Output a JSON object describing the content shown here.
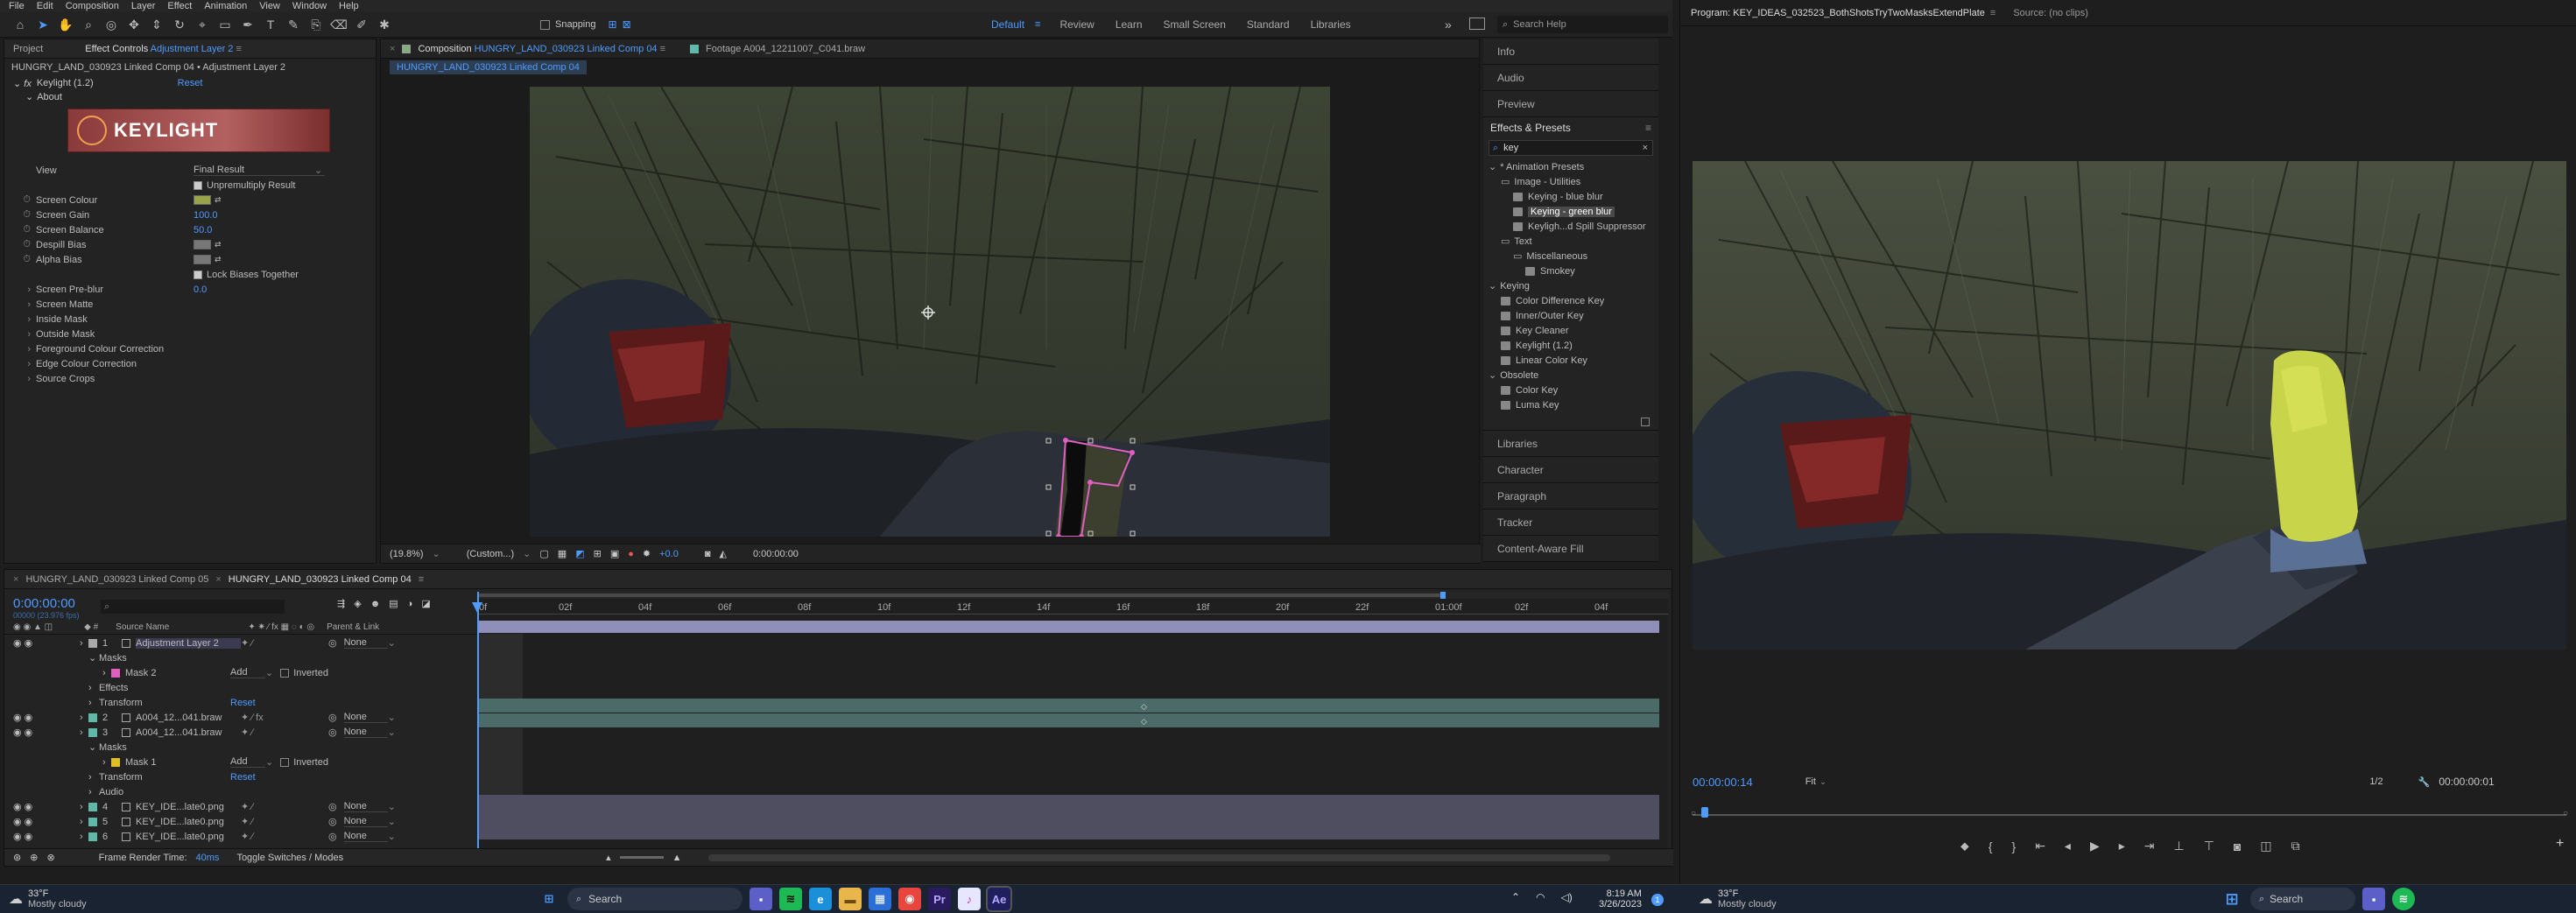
{
  "menu": [
    "File",
    "Edit",
    "Composition",
    "Layer",
    "Effect",
    "Animation",
    "View",
    "Window",
    "Help"
  ],
  "toolbar": {
    "snapping": "Snapping",
    "search_placeholder": "Search Help",
    "workspaces": [
      "Default",
      "Review",
      "Learn",
      "Small Screen",
      "Standard",
      "Libraries"
    ],
    "active_workspace": "Default",
    "more": "»"
  },
  "project_panel": {
    "tab_project": "Project",
    "tab_effect_controls": "Effect Controls",
    "effect_target": "Adjustment Layer 2",
    "path": "HUNGRY_LAND_030923 Linked Comp 04 • Adjustment Layer 2",
    "fx_name": "Keylight (1.2)",
    "reset": "Reset",
    "about": "About",
    "logo": "KEYLIGHT",
    "props": [
      {
        "label": "View",
        "value": "Final Result"
      },
      {
        "label": "",
        "value": "Unpremultiply Result"
      },
      {
        "label": "Screen Colour",
        "value": ""
      },
      {
        "label": "Screen Gain",
        "value": "100.0"
      },
      {
        "label": "Screen Balance",
        "value": "50.0"
      },
      {
        "label": "Despill Bias",
        "value": ""
      },
      {
        "label": "Alpha Bias",
        "value": ""
      },
      {
        "label": "",
        "value": "Lock Biases Together"
      },
      {
        "label": "Screen Pre-blur",
        "value": "0.0"
      },
      {
        "label": "Screen Matte",
        "value": ""
      },
      {
        "label": "Inside Mask",
        "value": ""
      },
      {
        "label": "Outside Mask",
        "value": ""
      },
      {
        "label": "Foreground Colour Correction",
        "value": ""
      },
      {
        "label": "Edge Colour Correction",
        "value": ""
      },
      {
        "label": "Source Crops",
        "value": ""
      }
    ]
  },
  "comp_panel": {
    "tab_comp_prefix": "Composition",
    "tab_comp_name": "HUNGRY_LAND_030923 Linked Comp 04",
    "tab_footage": "Footage  A004_12211007_C041.braw",
    "breadcrumb": "HUNGRY_LAND_030923 Linked Comp 04",
    "zoom": "(19.8%)",
    "resolution": "(Custom...)",
    "exposure": "+0.0",
    "timecode": "0:00:00:00"
  },
  "right_panels": {
    "top": [
      "Info",
      "Audio",
      "Preview"
    ],
    "effects_title": "Effects & Presets",
    "search_value": "key",
    "tree": [
      {
        "label": "* Animation Presets",
        "indent": 0,
        "type": "arrow"
      },
      {
        "label": "Image - Utilities",
        "indent": 1,
        "type": "folder"
      },
      {
        "label": "Keying - blue blur",
        "indent": 2,
        "type": "file"
      },
      {
        "label": "Keying - green blur",
        "indent": 2,
        "type": "file",
        "selected": true
      },
      {
        "label": "Keyligh...d Spill Suppressor",
        "indent": 2,
        "type": "file"
      },
      {
        "label": "Text",
        "indent": 1,
        "type": "folder"
      },
      {
        "label": "Miscellaneous",
        "indent": 2,
        "type": "folder"
      },
      {
        "label": "Smokey",
        "indent": 3,
        "type": "file"
      },
      {
        "label": "Keying",
        "indent": 0,
        "type": "arrow"
      },
      {
        "label": "Color Difference Key",
        "indent": 1,
        "type": "file"
      },
      {
        "label": "Inner/Outer Key",
        "indent": 1,
        "type": "file"
      },
      {
        "label": "Key Cleaner",
        "indent": 1,
        "type": "file"
      },
      {
        "label": "Keylight (1.2)",
        "indent": 1,
        "type": "file"
      },
      {
        "label": "Linear Color Key",
        "indent": 1,
        "type": "file"
      },
      {
        "label": "Obsolete",
        "indent": 0,
        "type": "arrow"
      },
      {
        "label": "Color Key",
        "indent": 1,
        "type": "file"
      },
      {
        "label": "Luma Key",
        "indent": 1,
        "type": "file"
      }
    ],
    "bottom": [
      "Libraries",
      "Character",
      "Paragraph",
      "Tracker",
      "Content-Aware Fill"
    ]
  },
  "timeline": {
    "tabs": [
      "HUNGRY_LAND_030923 Linked Comp 05",
      "HUNGRY_LAND_030923 Linked Comp 04"
    ],
    "timecode": "0:00:00:00",
    "timecode_sub": "00000 (23.976 fps)",
    "col_source": "Source Name",
    "col_parent": "Parent & Link",
    "ruler": [
      "0f",
      "02f",
      "04f",
      "06f",
      "08f",
      "10f",
      "12f",
      "14f",
      "16f",
      "18f",
      "20f",
      "22f",
      "01:00f",
      "02f",
      "04f"
    ],
    "layers": [
      {
        "num": "1",
        "name": "Adjustment Layer 2",
        "color": "#a9a9a9",
        "parent": "None",
        "kind": "layer"
      },
      {
        "num": "",
        "name": "Masks",
        "kind": "group1"
      },
      {
        "num": "",
        "name": "Mask 2",
        "color": "#e060c0",
        "kind": "mask",
        "mode": "Add",
        "inv": "Inverted"
      },
      {
        "num": "",
        "name": "Effects",
        "kind": "group1"
      },
      {
        "num": "",
        "name": "Transform",
        "kind": "group1",
        "reset": "Reset"
      },
      {
        "num": "2",
        "name": "A004_12...041.braw",
        "color": "#5fb8a8",
        "parent": "None",
        "kind": "layer"
      },
      {
        "num": "3",
        "name": "A004_12...041.braw",
        "color": "#5fb8a8",
        "parent": "None",
        "kind": "layer"
      },
      {
        "num": "",
        "name": "Masks",
        "kind": "group1"
      },
      {
        "num": "",
        "name": "Mask 1",
        "color": "#e0c020",
        "kind": "mask",
        "mode": "Add",
        "inv": "Inverted"
      },
      {
        "num": "",
        "name": "Transform",
        "kind": "group1",
        "reset": "Reset"
      },
      {
        "num": "",
        "name": "Audio",
        "kind": "group1"
      },
      {
        "num": "4",
        "name": "KEY_IDE...late0.png",
        "color": "#5fb8a8",
        "parent": "None",
        "kind": "layer"
      },
      {
        "num": "5",
        "name": "KEY_IDE...late0.png",
        "color": "#5fb8a8",
        "parent": "None",
        "kind": "layer"
      },
      {
        "num": "6",
        "name": "KEY_IDE...late0.png",
        "color": "#5fb8a8",
        "parent": "None",
        "kind": "layer"
      }
    ],
    "footer_render_label": "Frame Render Time:",
    "footer_render_value": "40ms",
    "footer_toggle": "Toggle Switches / Modes"
  },
  "program": {
    "title": "Program: KEY_IDEAS_032523_BothShotsTryTwoMasksExtendPlate",
    "source": "Source: (no clips)",
    "timecode": "00:00:00:14",
    "fit": "Fit",
    "ratio": "1/2",
    "duration": "00:00:00:01"
  },
  "taskbar": {
    "weather_temp": "33°F",
    "weather_desc": "Mostly cloudy",
    "search": "Search",
    "time": "8:19 AM",
    "date": "3/26/2023",
    "apps": [
      "Win",
      "Chat",
      "Spotify",
      "Edge",
      "Files",
      "Store",
      "Chrome",
      "Premiere",
      "Music",
      "AfterEffects"
    ],
    "notif": "1"
  }
}
